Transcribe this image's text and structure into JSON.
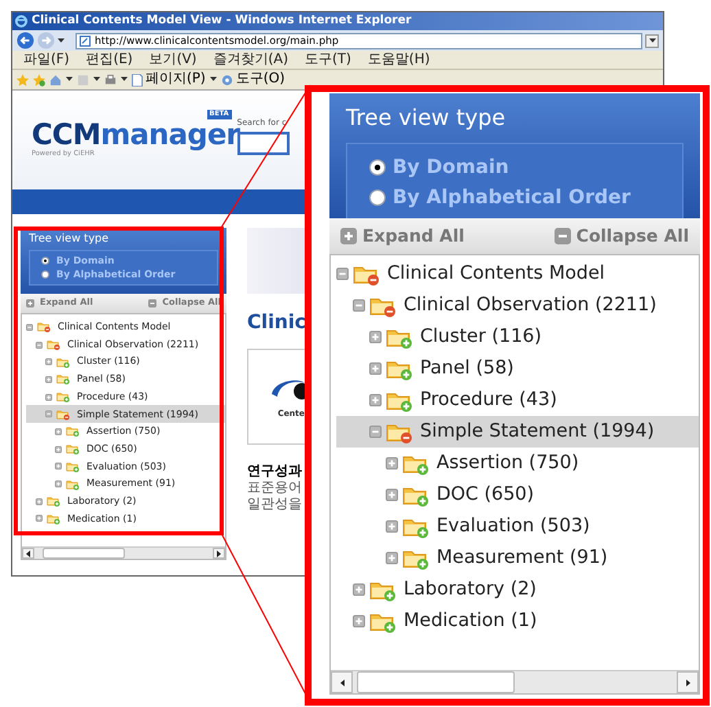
{
  "browser": {
    "title": "Clinical Contents Model View - Windows Internet Explorer",
    "url": "http://www.clinicalcontentsmodel.org/main.php",
    "menu": [
      "파일(F)",
      "편집(E)",
      "보기(V)",
      "즐겨찾기(A)",
      "도구(T)",
      "도움말(H)"
    ],
    "toolbar": [
      "페이지(P)",
      "도구(O)"
    ]
  },
  "page": {
    "logo": {
      "name_dark": "CCM",
      "name_light": "manager",
      "badge": "BETA",
      "tagline": "Powered by CiEHR"
    },
    "search_label": "Search for c",
    "heading": "Clinic",
    "card_caption": "Cente",
    "news_title": "연구성과",
    "news_lines": [
      "표준용어",
      "일관성을"
    ]
  },
  "tree_panel": {
    "title": "Tree view type",
    "options": [
      {
        "label": "By Domain",
        "selected": true
      },
      {
        "label": "By Alphabetical Order",
        "selected": false
      }
    ],
    "expand_all": "Expand All",
    "collapse_all": "Collapse All",
    "tree": [
      {
        "label": "Clinical Contents Model",
        "expanded": true,
        "selected": false,
        "children": [
          {
            "label": "Clinical Observation (2211)",
            "expanded": true,
            "selected": false,
            "children": [
              {
                "label": "Cluster (116)",
                "expanded": false,
                "selected": false
              },
              {
                "label": "Panel (58)",
                "expanded": false,
                "selected": false
              },
              {
                "label": "Procedure (43)",
                "expanded": false,
                "selected": false
              },
              {
                "label": "Simple Statement (1994)",
                "expanded": true,
                "selected": true,
                "children": [
                  {
                    "label": "Assertion (750)",
                    "expanded": false,
                    "selected": false
                  },
                  {
                    "label": "DOC (650)",
                    "expanded": false,
                    "selected": false
                  },
                  {
                    "label": "Evaluation (503)",
                    "expanded": false,
                    "selected": false
                  },
                  {
                    "label": "Measurement (91)",
                    "expanded": false,
                    "selected": false
                  }
                ]
              }
            ]
          },
          {
            "label": "Laboratory (2)",
            "expanded": false,
            "selected": false
          },
          {
            "label": "Medication (1)",
            "expanded": false,
            "selected": false
          }
        ]
      }
    ]
  },
  "zoomed_tree_panel": {
    "title": "Tree view type",
    "options": [
      {
        "label": "By Domain",
        "selected": true
      },
      {
        "label": "By Alphabetical Order",
        "selected": false
      }
    ],
    "expand_all": "Expand All",
    "collapse_all": "Collapse All",
    "tree": [
      {
        "label": "Clinical Contents Model",
        "expanded": true,
        "selected": false,
        "children": [
          {
            "label": "Clinical Observation (2211)",
            "expanded": true,
            "selected": false,
            "children": [
              {
                "label": "Cluster (116)",
                "expanded": false,
                "selected": false
              },
              {
                "label": "Panel (58)",
                "expanded": false,
                "selected": false
              },
              {
                "label": "Procedure (43)",
                "expanded": false,
                "selected": false
              },
              {
                "label": "Simple Statement (1994)",
                "expanded": true,
                "selected": true,
                "children": [
                  {
                    "label": "Assertion (750)",
                    "expanded": false,
                    "selected": false
                  },
                  {
                    "label": "DOC (650)",
                    "expanded": false,
                    "selected": false
                  },
                  {
                    "label": "Evaluation (503)",
                    "expanded": false,
                    "selected": false
                  },
                  {
                    "label": "Measurement (91)",
                    "expanded": false,
                    "selected": false
                  }
                ]
              }
            ]
          },
          {
            "label": "Laboratory (2)",
            "expanded": false,
            "selected": false
          },
          {
            "label": "Medication (1)",
            "expanded": false,
            "selected": false
          }
        ]
      }
    ]
  }
}
